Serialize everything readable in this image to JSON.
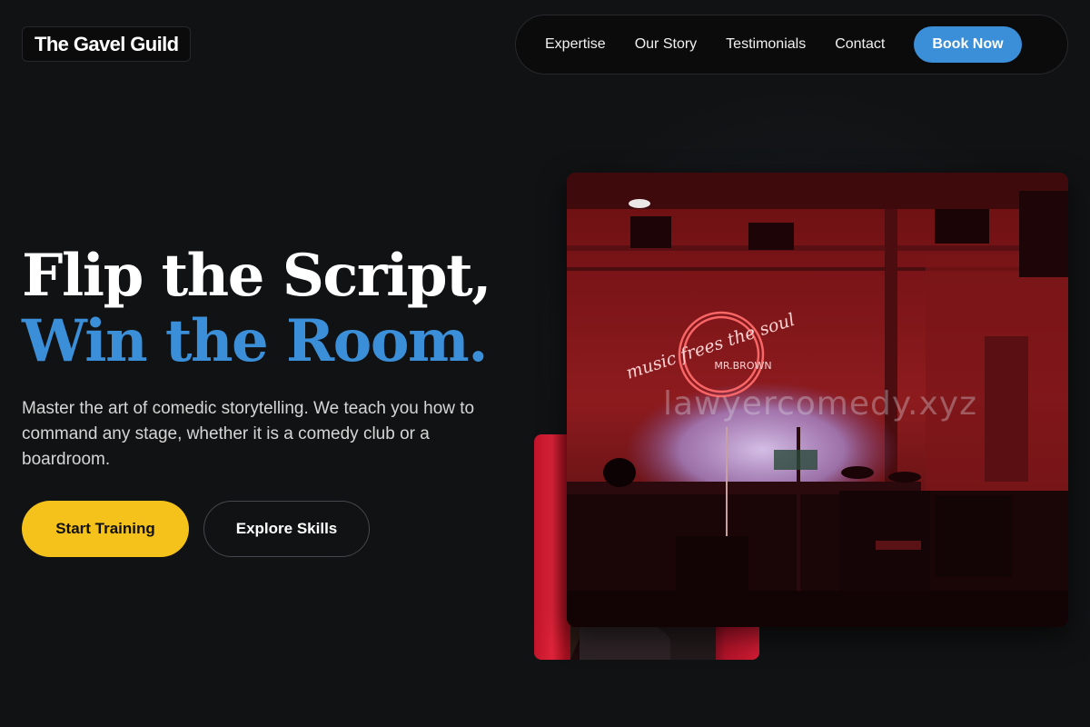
{
  "brand": {
    "name": "The Gavel Guild"
  },
  "nav": {
    "links": [
      "Expertise",
      "Our Story",
      "Testimonials",
      "Contact"
    ],
    "cta": "Book Now"
  },
  "hero": {
    "headline_line1": "Flip the Script,",
    "headline_line2": "Win the Room.",
    "subtitle": "Master the art of comedic storytelling. We teach you how to command any stage, whether it is a comedy club or a boardroom.",
    "primary_button": "Start Training",
    "secondary_button": "Explore Skills"
  },
  "stage_image": {
    "neon_text": "music frees the soul",
    "neon_subtext": "MR.BROWN",
    "watermark": "lawyercomedy.xyz"
  },
  "colors": {
    "background": "#111213",
    "accent_blue": "#3a8fd8",
    "accent_yellow": "#f4c21a"
  }
}
